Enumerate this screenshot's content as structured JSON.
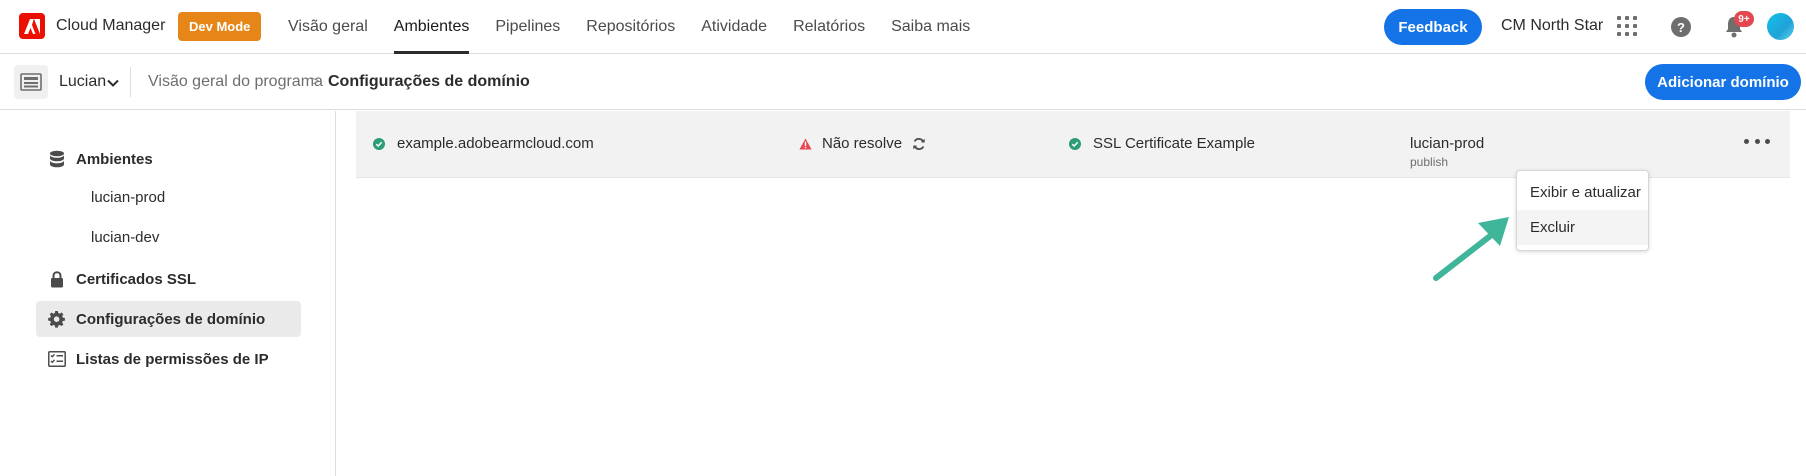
{
  "app": {
    "title": "Cloud Manager",
    "dev_mode_label": "Dev Mode",
    "brand_color": "#eb1000",
    "accent_color": "#1473e6"
  },
  "nav": {
    "items": [
      {
        "label": "Visão geral",
        "active": false
      },
      {
        "label": "Ambientes",
        "active": true
      },
      {
        "label": "Pipelines",
        "active": false
      },
      {
        "label": "Repositórios",
        "active": false
      },
      {
        "label": "Atividade",
        "active": false
      },
      {
        "label": "Relatórios",
        "active": false
      },
      {
        "label": "Saiba mais",
        "active": false
      }
    ],
    "feedback_label": "Feedback",
    "org_name": "CM North Star",
    "notification_badge": "9+",
    "help_glyph": "?"
  },
  "subbar": {
    "program_name": "Lucian",
    "breadcrumb": [
      "Visão geral do programa",
      "Configurações de domínio"
    ],
    "breadcrumb_separator": ">",
    "add_domain_label": "Adicionar domínio"
  },
  "sidebar": {
    "items": [
      {
        "label": "Ambientes",
        "icon": "database-icon"
      },
      {
        "label": "lucian-prod",
        "sub": true
      },
      {
        "label": "lucian-dev",
        "sub": true
      },
      {
        "label": "Certificados SSL",
        "icon": "lock-icon"
      },
      {
        "label": "Configurações de domínio",
        "icon": "gear-icon",
        "active": true
      },
      {
        "label": "Listas de permissões de IP",
        "icon": "checklist-icon"
      }
    ]
  },
  "domain_row": {
    "domain": "example.adobearmcloud.com",
    "dns_status": "Não resolve",
    "certificate": "SSL Certificate Example",
    "environment": "lucian-prod",
    "tier": "publish",
    "ok_color": "#2d9d78",
    "warning_color": "#e34850"
  },
  "context_menu": {
    "items": [
      "Exibir e atualizar",
      "Excluir"
    ]
  },
  "annotation": {
    "arrow_color": "#3fb59a"
  }
}
